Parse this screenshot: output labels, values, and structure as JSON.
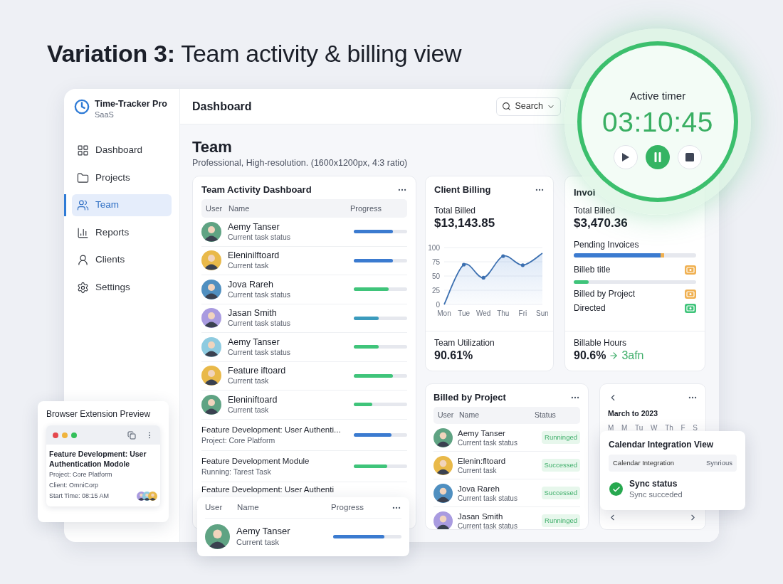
{
  "heading": "**Variation 3:** Team activity & billing view",
  "app": {
    "name": "Time-Tracker Pro",
    "plan": "SaaS"
  },
  "sidebar": {
    "items": [
      {
        "label": "Dashboard",
        "selected": false
      },
      {
        "label": "Projects",
        "selected": false
      },
      {
        "label": "Team",
        "selected": true
      },
      {
        "label": "Reports",
        "selected": false
      },
      {
        "label": "Clients",
        "selected": false
      },
      {
        "label": "Settings",
        "selected": false
      }
    ]
  },
  "topbar": {
    "title": "Dashboard",
    "search": "Search"
  },
  "page": {
    "title": "Team",
    "subtitle": "Professional, High-resolution. (1600x1200px, 4:3 ratio)"
  },
  "team_activity": {
    "title": "Team Activity Dashboard",
    "columns": [
      "User",
      "Name",
      "Progress"
    ],
    "rows": [
      {
        "kind": "person",
        "name": "Aemy Tanser",
        "status": "Current task status",
        "level": 0.73,
        "color": "#3b7bd0"
      },
      {
        "kind": "person",
        "name": "Eleninilftoard",
        "status": "Current task",
        "level": 0.73,
        "color": "#3b7bd0"
      },
      {
        "kind": "person",
        "name": "Jova Rareh",
        "status": "Current task status",
        "level": 0.65,
        "color": "#3fc47a"
      },
      {
        "kind": "person",
        "name": "Jasan Smith",
        "status": "Current task status",
        "level": 0.47,
        "color": "#3b9bbd"
      },
      {
        "kind": "person",
        "name": "Aemy Tanser",
        "status": "Current task status",
        "level": 0.47,
        "color": "#3fc47a"
      },
      {
        "kind": "person",
        "name": "Feature iftoard",
        "status": "Current task",
        "level": 0.73,
        "color": "#3fc47a"
      },
      {
        "kind": "person",
        "name": "Eleniniftoard",
        "status": "Current task",
        "level": 0.35,
        "color": "#3fc47a"
      },
      {
        "kind": "task",
        "name": "Feature Development: User Authenti...",
        "status": "Project: Core Platform",
        "level": 0.71,
        "color": "#3b7bd0"
      },
      {
        "kind": "task",
        "name": "Feature Development Module",
        "status": "Running: Tarest Task",
        "level": 0.63,
        "color": "#3fc47a"
      },
      {
        "kind": "task",
        "name": "Feature Development: User Authenti"
      }
    ]
  },
  "client_billing": {
    "title": "Client Billing",
    "total_label": "Total Billed",
    "total": "$13,143.85",
    "chart_data": {
      "type": "area",
      "categories": [
        "Mon",
        "Tue",
        "Wed",
        "Thu",
        "Fri",
        "Sun"
      ],
      "values": [
        0,
        70,
        47,
        85,
        69,
        90
      ],
      "ylim": [
        0,
        100
      ],
      "grid": true,
      "yticks": [
        0,
        25,
        50,
        75,
        100
      ]
    },
    "footer_label": "Team Utilization",
    "footer_value": "90.61%"
  },
  "invoices": {
    "title": "Invoi",
    "total_label": "Total Billed",
    "total": "$3,470.36",
    "pending": {
      "label": "Pending Invoices",
      "level": 0.71
    },
    "items": [
      {
        "label": "Billeb title",
        "color": "#f0b050",
        "level": 0.12
      },
      {
        "label": "Billed by Project",
        "color": "#f0b050"
      },
      {
        "label": "Directed",
        "color": "#3fc47a"
      }
    ],
    "footer_label": "Billable Hours",
    "footer_value": "90.6%",
    "footer_trend": "3afn"
  },
  "billed_by_project": {
    "title": "Billed by Project",
    "columns": [
      "User",
      "Name",
      "Status"
    ],
    "rows": [
      {
        "name": "Aemy Tanser",
        "status": "Current task status",
        "badge": "Runninged"
      },
      {
        "name": "Elenin:fltoard",
        "status": "Current task",
        "badge": "Successed"
      },
      {
        "name": "Jova Rareh",
        "status": "Current task status",
        "badge": "Successed"
      },
      {
        "name": "Jasan Smith",
        "status": "Current task status",
        "badge": "Runninged"
      }
    ]
  },
  "calendar": {
    "month": "March to 2023",
    "weekdays": [
      "M",
      "M",
      "Tu",
      "W",
      "Th",
      "F",
      "S"
    ]
  },
  "calendar_popup": {
    "title": "Calendar Integration View",
    "header_left": "Calendar Integration",
    "header_right": "Synrious",
    "status_title": "Sync status",
    "status_detail": "Sync succeded"
  },
  "timer": {
    "label": "Active timer",
    "time": "03:10:45",
    "controls": [
      {
        "kind": "play",
        "selected": false
      },
      {
        "kind": "pause",
        "selected": true
      },
      {
        "kind": "stop",
        "selected": false
      }
    ]
  },
  "extension": {
    "title": "Browser Extension Preview",
    "task": "Feature Development: User Authentication Modole",
    "lines": [
      "Project: Core Platform",
      "Client: OmniCorp",
      "Start Time: 08:15 AM"
    ]
  },
  "floating_row": {
    "columns": [
      "User",
      "Name",
      "Progress"
    ],
    "name": "Aemy Tanser",
    "status": "Current task",
    "level": 0.75,
    "color": "#3b7bd0"
  }
}
